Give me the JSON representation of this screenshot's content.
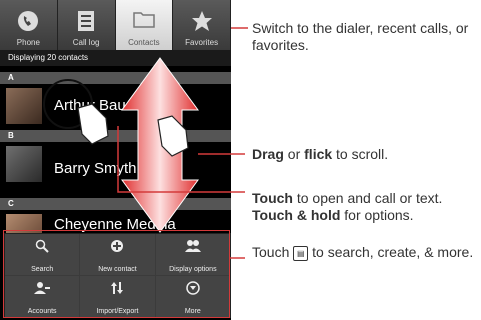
{
  "tabs": [
    {
      "label": "Phone",
      "icon": "phone-icon"
    },
    {
      "label": "Call log",
      "icon": "call-log-icon"
    },
    {
      "label": "Contacts",
      "icon": "contacts-icon"
    },
    {
      "label": "Favorites",
      "icon": "star-icon"
    }
  ],
  "contacts": {
    "count_text": "Displaying 20 contacts",
    "sections": [
      {
        "letter": "A",
        "name": "Arthur Baudo"
      },
      {
        "letter": "B",
        "name": "Barry Smyth"
      },
      {
        "letter": "C",
        "name": "Cheyenne Medina"
      }
    ]
  },
  "menu": [
    {
      "label": "Search",
      "icon": "search-icon"
    },
    {
      "label": "New contact",
      "icon": "add-icon"
    },
    {
      "label": "Display options",
      "icon": "display-options-icon"
    },
    {
      "label": "Accounts",
      "icon": "accounts-icon"
    },
    {
      "label": "Import/Export",
      "icon": "import-export-icon"
    },
    {
      "label": "More",
      "icon": "more-icon"
    }
  ],
  "callouts": {
    "tabs": "Switch to the dialer, recent calls, or favorites.",
    "scroll_bold1": "Drag",
    "scroll_or": " or ",
    "scroll_bold2": "flick",
    "scroll_rest": " to scroll.",
    "touch_bold1": "Touch",
    "touch_rest1": " to open and call or text.",
    "touch_bold2": "Touch & hold",
    "touch_rest2": " for options.",
    "menu_pre": "Touch ",
    "menu_post": " to search, create, & more."
  },
  "colors": {
    "accent_red": "#d43a3a",
    "arrow_red": "#e03030"
  }
}
